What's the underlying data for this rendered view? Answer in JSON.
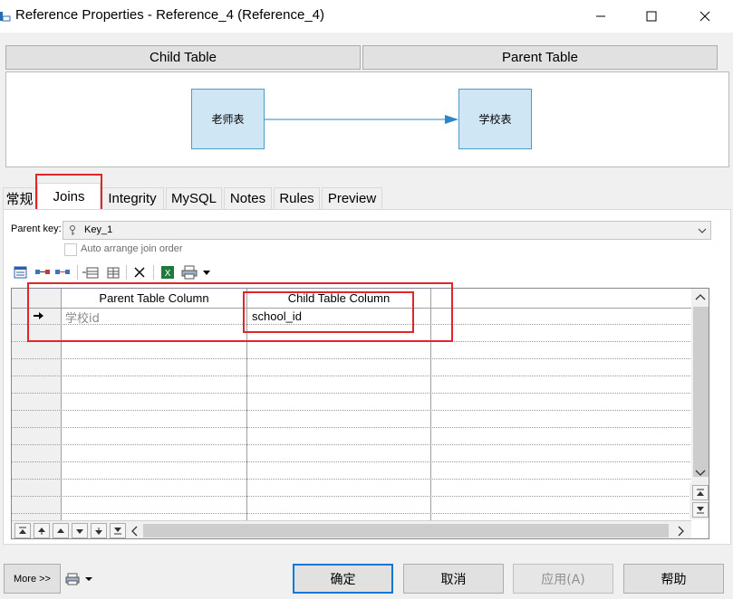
{
  "window": {
    "title": "Reference Properties - Reference_4 (Reference_4)"
  },
  "header": {
    "child_table": "Child Table",
    "parent_table": "Parent Table"
  },
  "diagram": {
    "child_entity": "老师表",
    "parent_entity": "学校表"
  },
  "tabs": [
    "常规",
    "Joins",
    "Integrity",
    "MySQL",
    "Notes",
    "Rules",
    "Preview"
  ],
  "active_tab": "Joins",
  "joins": {
    "parent_key_label": "Parent key:",
    "parent_key_value": "Key_1",
    "auto_arrange_label": "Auto arrange join order",
    "auto_arrange_checked": false,
    "grid": {
      "columns": [
        "Parent Table Column",
        "Child Table Column"
      ],
      "rows": [
        {
          "parent": "学校id",
          "child": "school_id"
        }
      ]
    }
  },
  "footer": {
    "more_label": "More >>",
    "ok": "确定",
    "cancel": "取消",
    "apply": "应用(A)",
    "help": "帮助"
  },
  "colors": {
    "accent": "#0078d7",
    "highlight_box": "#e0262a",
    "entity_fill": "#cfe6f5",
    "entity_border": "#4a9ccd"
  }
}
